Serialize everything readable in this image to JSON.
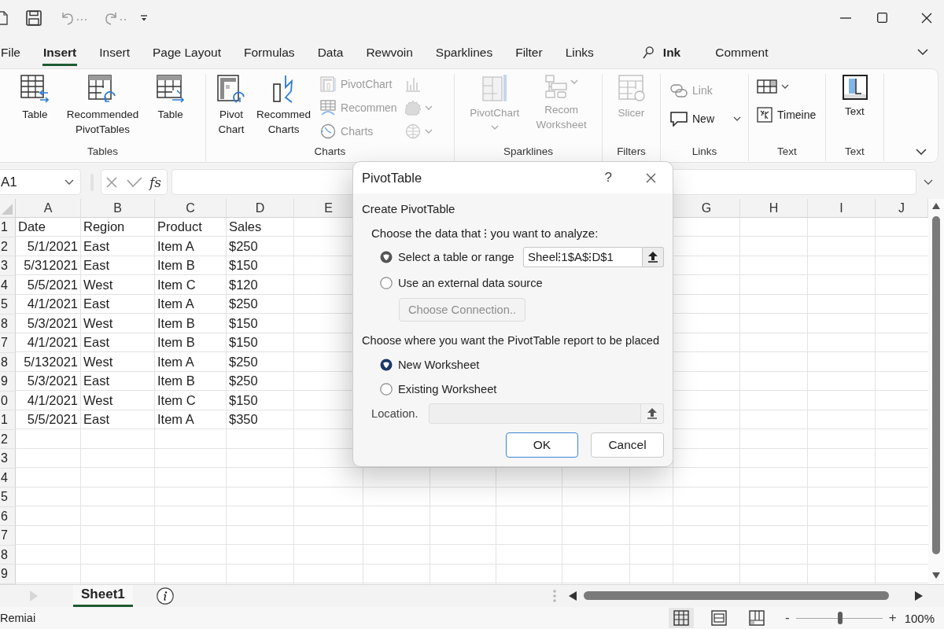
{
  "menu_tabs": [
    {
      "label": "File",
      "kind": "tab",
      "selected": false
    },
    {
      "label": "Insert",
      "kind": "tab",
      "selected": true
    },
    {
      "label": "Insert",
      "kind": "tab",
      "selected": false
    },
    {
      "label": "Page Layout",
      "kind": "tab",
      "selected": false
    },
    {
      "label": "Formulas",
      "kind": "tab",
      "selected": false
    },
    {
      "label": "Data",
      "kind": "tab",
      "selected": false
    },
    {
      "label": "Rewvoin",
      "kind": "tab",
      "selected": false
    },
    {
      "label": "Sparklines",
      "kind": "tab",
      "selected": false
    },
    {
      "label": "Filter",
      "kind": "tab",
      "selected": false
    },
    {
      "label": "Links",
      "kind": "tab",
      "selected": false
    },
    {
      "label": "Ink",
      "kind": "search",
      "selected": false
    },
    {
      "label": "Comment",
      "kind": "tab",
      "selected": false
    }
  ],
  "ribbon": {
    "groups": [
      {
        "label": "Tables",
        "items": [
          {
            "kind": "large",
            "label": "Table",
            "disabled": false,
            "dropdown": false
          },
          {
            "kind": "large",
            "label": "Recommended PivotTables",
            "disabled": false,
            "dropdown": false
          },
          {
            "kind": "large",
            "label": "Table",
            "disabled": false,
            "dropdown": false
          }
        ]
      },
      {
        "label": "Charts",
        "items": [
          {
            "kind": "large",
            "label": "Pivot Chart",
            "disabled": false,
            "dropdown": false
          },
          {
            "kind": "large",
            "label": "Recommed Charts",
            "disabled": false,
            "dropdown": false
          },
          {
            "kind": "stack",
            "items": [
              {
                "kind": "small",
                "label": "PivotChart",
                "disabled": true,
                "dropdown": false
              },
              {
                "kind": "small",
                "label": "Recommen",
                "disabled": true,
                "dropdown": false
              },
              {
                "kind": "small",
                "label": "Charts",
                "disabled": true,
                "dropdown": false
              }
            ]
          },
          {
            "kind": "stack",
            "items": [
              {
                "kind": "icon",
                "disabled": true,
                "dropdown": false
              },
              {
                "kind": "icon",
                "disabled": true,
                "dropdown": true
              },
              {
                "kind": "icon",
                "disabled": true,
                "dropdown": true
              }
            ]
          }
        ]
      },
      {
        "label": "Sparklines",
        "items": [
          {
            "kind": "large",
            "label": "PivotChart",
            "disabled": true,
            "dropdown": true
          },
          {
            "kind": "menu",
            "label": "Recom Worksheet",
            "disabled": true,
            "dropdown": true
          }
        ]
      },
      {
        "label": "Filters",
        "items": [
          {
            "kind": "large",
            "label": "Slicer",
            "disabled": true,
            "dropdown": false
          }
        ]
      },
      {
        "label": "Links",
        "items": [
          {
            "kind": "stack",
            "items": [
              {
                "kind": "small",
                "label": "Link",
                "disabled": true,
                "dropdown": false
              },
              {
                "kind": "small",
                "label": "New",
                "disabled": false,
                "dropdown": true
              }
            ]
          }
        ]
      },
      {
        "label": "Text",
        "items": [
          {
            "kind": "stack",
            "items": [
              {
                "kind": "icon",
                "disabled": false,
                "dropdown": true
              },
              {
                "kind": "small",
                "label": "Timeine",
                "disabled": false,
                "dropdown": false
              }
            ]
          }
        ]
      },
      {
        "label": "Text",
        "items": [
          {
            "kind": "large",
            "label": "Text",
            "disabled": false,
            "dropdown": false
          }
        ]
      }
    ]
  },
  "formula_bar": {
    "name_box": "A1",
    "function_label": "fs"
  },
  "sheet": {
    "columns": [
      "A",
      "B",
      "C",
      "D",
      "E",
      "G",
      "H",
      "I",
      "J"
    ],
    "rows": [
      {
        "number": "1",
        "kind": "header",
        "cells": [
          "Date",
          "Region",
          "Product",
          "Sales"
        ]
      },
      {
        "number": "2",
        "kind": "data",
        "cells": [
          "5/1/2021",
          "East",
          "Item A",
          "$250"
        ]
      },
      {
        "number": "3",
        "kind": "data",
        "cells": [
          "5/312021",
          "East",
          "Item B",
          "$150"
        ]
      },
      {
        "number": "4",
        "kind": "data",
        "cells": [
          "5/5/2021",
          "West",
          "Item C",
          "$120"
        ]
      },
      {
        "number": "5",
        "kind": "data",
        "cells": [
          "4/1/2021",
          "East",
          "Item A",
          "$250"
        ]
      },
      {
        "number": "8",
        "kind": "data",
        "cells": [
          "5/3/2021",
          "West",
          "Item B",
          "$150"
        ]
      },
      {
        "number": "7",
        "kind": "data",
        "cells": [
          "4/1/2021",
          "East",
          "Item B",
          "$150"
        ]
      },
      {
        "number": "8",
        "kind": "data",
        "cells": [
          "5/132021",
          "West",
          "Item A",
          "$250"
        ]
      },
      {
        "number": "9",
        "kind": "data",
        "cells": [
          "5/3/2021",
          "East",
          "Item B",
          "$250"
        ]
      },
      {
        "number": "0",
        "kind": "data",
        "cells": [
          "4/1/2021",
          "West",
          "Item C",
          "$150"
        ]
      },
      {
        "number": "1",
        "kind": "data",
        "cells": [
          "5/5/2021",
          "East",
          "Item A",
          "$350"
        ]
      },
      {
        "number": "2",
        "kind": "data"
      },
      {
        "number": "3",
        "kind": "data"
      },
      {
        "number": "4",
        "kind": "data"
      },
      {
        "number": "5",
        "kind": "data"
      },
      {
        "number": "6",
        "kind": "data"
      },
      {
        "number": "7",
        "kind": "data"
      },
      {
        "number": "8",
        "kind": "data"
      },
      {
        "number": "9",
        "kind": "data"
      }
    ]
  },
  "dialog": {
    "title": "PivotTable",
    "help": "?",
    "section_title": "Create PivotTable",
    "data_prompt": "Choose the data that ⁝ you want to analyze:",
    "data_options": [
      {
        "label": "Select a table or range",
        "selected": true,
        "value": "Sheel⁝1$A$⁝D$1"
      },
      {
        "label": "Use an external data source",
        "selected": false
      }
    ],
    "connection_button": {
      "label": "Choose Connection..",
      "disabled": true
    },
    "placement_prompt": "Choose where you want the PivotTable report to be placed",
    "placement_options": [
      {
        "label": "New Worksheet",
        "selected": true
      },
      {
        "label": "Existing Worksheet",
        "selected": false
      }
    ],
    "location_label": "Location.",
    "buttons": [
      {
        "label": "OK",
        "default": true
      },
      {
        "label": "Cancel",
        "default": false
      }
    ]
  },
  "sheet_tabs": [
    {
      "label": "Sheet1",
      "selected": true
    }
  ],
  "status_bar": {
    "text": "Remiai",
    "views": [
      {
        "selected": true
      },
      {
        "selected": false
      },
      {
        "selected": false
      }
    ],
    "zoom": {
      "minus": "-",
      "plus": "+",
      "level": 0.51,
      "reading": "100%"
    }
  }
}
